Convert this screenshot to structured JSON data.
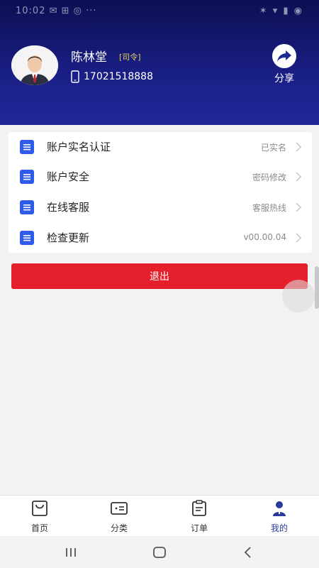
{
  "status_bar": {
    "left_text": "10:02 ✉ ⊞ ◎ ···",
    "right_text": "✶ ▾ ▮ ◉"
  },
  "profile": {
    "name": "陈林堂",
    "role": "[司令]",
    "phone": "17021518888",
    "share_label": "分享",
    "icons": {
      "avatar": "avatar-icon",
      "phone": "phone-icon",
      "share": "share-icon"
    },
    "colors": {
      "header": "#1a1f86",
      "role": "#e8d15a"
    }
  },
  "menu": {
    "items": [
      {
        "label": "账户实名认证",
        "value": "已实名",
        "icon": "document-icon"
      },
      {
        "label": "账户安全",
        "value": "密码修改",
        "icon": "document-icon"
      },
      {
        "label": "在线客服",
        "value": "客服热线",
        "icon": "document-icon"
      },
      {
        "label": "检查更新",
        "value": "v00.00.04",
        "icon": "document-icon"
      }
    ],
    "colors": {
      "icon": "#2f5bea"
    }
  },
  "logout": {
    "label": "退出",
    "color": "#e51f2b"
  },
  "tabbar": {
    "tabs": [
      {
        "label": "首页",
        "icon": "shopping-bag-icon",
        "active": false
      },
      {
        "label": "分类",
        "icon": "category-icon",
        "active": false
      },
      {
        "label": "订单",
        "icon": "order-icon",
        "active": false
      },
      {
        "label": "我的",
        "icon": "person-icon",
        "active": true
      }
    ],
    "colors": {
      "active": "#2a3a9a"
    }
  },
  "system_nav": {
    "recent": "recent-apps-icon",
    "home": "home-icon",
    "back": "back-icon"
  }
}
